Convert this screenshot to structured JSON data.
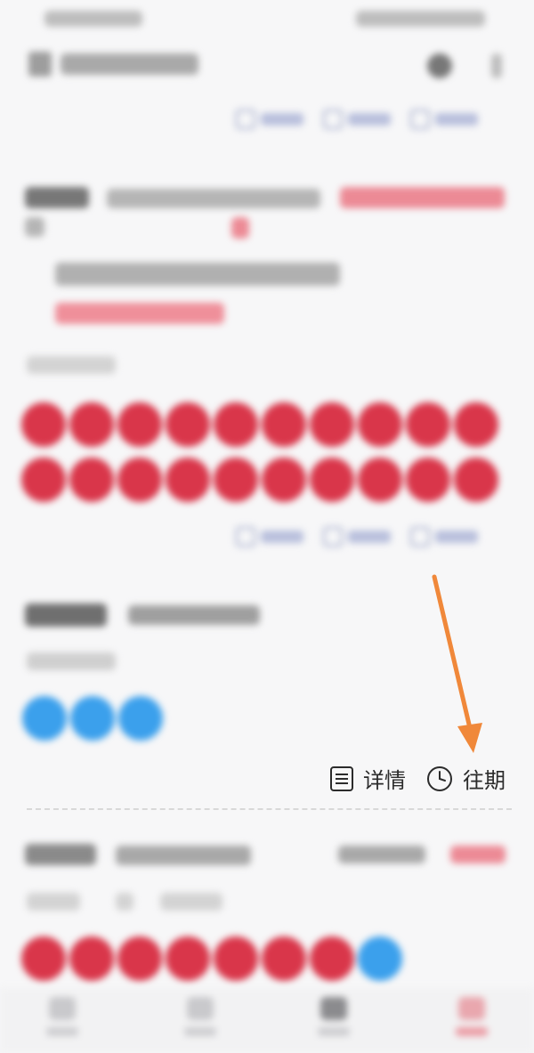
{
  "links": {
    "detail_label": "详情",
    "history_label": "往期"
  },
  "icons": {
    "detail": "list-document-icon",
    "history": "clock-icon",
    "annotation": "orange-arrow"
  },
  "colors": {
    "red_ball": "#d9364a",
    "blue_ball": "#3ba0ec",
    "accent_red": "#e0485b",
    "arrow": "#f0883a"
  }
}
